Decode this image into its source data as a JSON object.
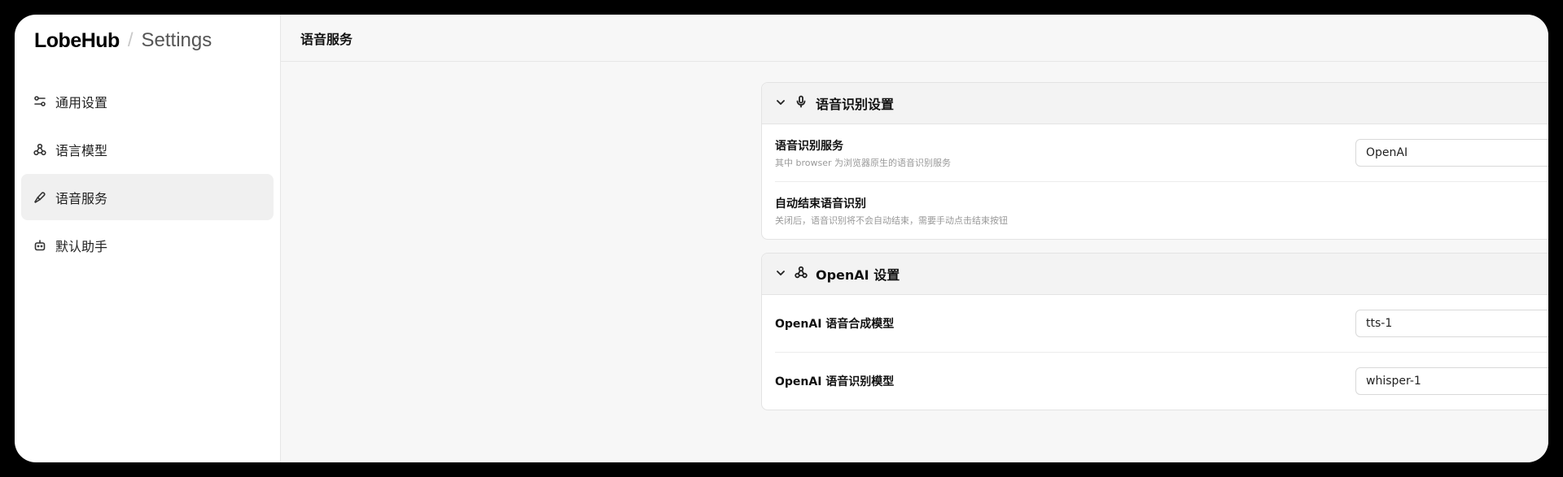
{
  "brand": {
    "logo": "LobeHub",
    "separator": "/",
    "title": "Settings"
  },
  "sidebar": {
    "items": [
      {
        "label": "通用设置",
        "icon": "settings-sliders-icon",
        "active": false
      },
      {
        "label": "语言模型",
        "icon": "model-icon",
        "active": false
      },
      {
        "label": "语音服务",
        "icon": "mic-icon",
        "active": true
      },
      {
        "label": "默认助手",
        "icon": "bot-icon",
        "active": false
      }
    ]
  },
  "topbar": {
    "title": "语音服务"
  },
  "speech_section": {
    "title": "语音识别设置",
    "icon": "mic-icon",
    "rows": [
      {
        "title": "语音识别服务",
        "desc": "其中 browser 为浏览器原生的语音识别服务",
        "value": "OpenAI"
      },
      {
        "title": "自动结束语音识别",
        "desc": "关闭后，语音识别将不会自动结束，需要手动点击结束按钮",
        "toggle": true
      }
    ]
  },
  "openai_section": {
    "title": "OpenAI 设置",
    "icon": "openai-icon",
    "rows": [
      {
        "title": "OpenAI 语音合成模型",
        "value": "tts-1"
      },
      {
        "title": "OpenAI 语音识别模型",
        "value": "whisper-1"
      }
    ]
  },
  "colors": {
    "accent": "#222222",
    "active_bg": "#f0f0f0"
  }
}
